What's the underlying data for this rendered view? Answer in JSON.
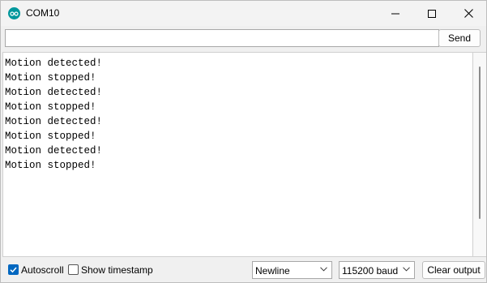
{
  "window": {
    "title": "COM10",
    "accent_color": "#00979c",
    "controls": {
      "minimize_icon": "minimize-icon",
      "maximize_icon": "maximize-icon",
      "close_icon": "close-icon"
    }
  },
  "send_bar": {
    "input_value": "",
    "send_label": "Send"
  },
  "output": {
    "lines": [
      "Motion detected!",
      "Motion stopped!",
      "Motion detected!",
      "Motion stopped!",
      "Motion detected!",
      "Motion stopped!",
      "Motion detected!",
      "Motion stopped!"
    ]
  },
  "bottom_bar": {
    "autoscroll": {
      "label": "Autoscroll",
      "checked": true
    },
    "timestamp": {
      "label": "Show timestamp",
      "checked": false
    },
    "line_ending": {
      "selected": "Newline"
    },
    "baud_rate": {
      "selected": "115200 baud"
    },
    "clear_label": "Clear output",
    "checkbox_color": "#0067c0"
  }
}
